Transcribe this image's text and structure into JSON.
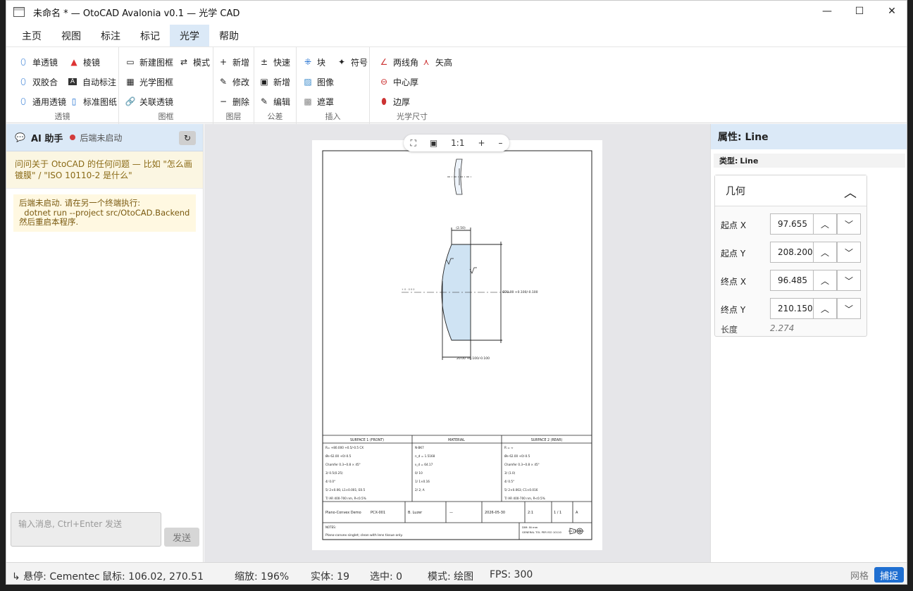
{
  "window": {
    "title": "未命名 * — OtoCAD Avalonia v0.1 — 光学 CAD",
    "min_glyph": "—",
    "max_glyph": "☐",
    "close_glyph": "✕"
  },
  "menu": [
    "主页",
    "视图",
    "标注",
    "标记",
    "光学",
    "帮助"
  ],
  "ribbon": {
    "groups": {
      "lens": "透镜",
      "frame": "图框",
      "layer": "图层",
      "tolerance": "公差",
      "insert": "插入",
      "optical_dim": "光学尺寸"
    },
    "lens": {
      "single": "单透镜",
      "doublet": "双胶合",
      "generic": "通用透镜",
      "prism": "棱镜",
      "auto_dim": "自动标注",
      "std_sheet": "标准图纸"
    },
    "frame": {
      "new": "新建图框",
      "mode": "模式",
      "optical": "光学图框",
      "link": "关联透镜"
    },
    "layer": {
      "add": "新增",
      "edit": "修改",
      "delete": "删除"
    },
    "tolerance": {
      "quick": "快速",
      "new": "新增",
      "edit": "编辑"
    },
    "insert": {
      "block": "块",
      "symbol": "符号",
      "image": "图像",
      "mask": "遮罩"
    },
    "optical_dim": {
      "two_line_angle": "两线角",
      "sag": "矢高",
      "center_thick": "中心厚",
      "edge_thick": "边厚"
    }
  },
  "ai": {
    "title": "AI 助手",
    "status": "后端未启动",
    "hint": "问问关于 OtoCAD 的任何问题 — 比如 \"怎么画镀膜\" / \"ISO 10110-2 是什么\"",
    "warn_lines": [
      "后端未启动. 请在另一个终端执行:",
      "  dotnet run --project src/OtoCAD.Backend",
      "然后重启本程序."
    ],
    "placeholder": "输入消息, Ctrl+Enter 发送",
    "send": "发送"
  },
  "zoom_toolbar": {
    "fit": "⛶",
    "frame": "▣",
    "one_to_one": "1:1",
    "plus": "+",
    "minus": "–"
  },
  "drawing": {
    "dim_top": "(2.50)",
    "dim_diameter": "Ø70.00 +0.100/-0.100",
    "dim_bottom": "20.00 +0.100/-0.100",
    "axis_label": "+ 0 . 0 0 0",
    "table_headers": [
      "SURFACE 1 (FRONT)",
      "MATERIAL",
      "SURFACE 2 (REAR)"
    ],
    "surface1": [
      "R= +80.000 +0.5/-0.5 CX",
      "Øe 62.00 +0/-0.5",
      "Chamfer 0.3~0.8 × 45°",
      "3/ 0.5(0.25)",
      "4/ 0.0°",
      "5/ 2×0.06; L1×0.001; E0.5",
      "T/ AR 400-700 nm, R<0.5%"
    ],
    "material": [
      "N-BK7",
      "n_d = 1.5168",
      "ν_d = 64.17",
      "0/ 10",
      "1/ 1×0.16",
      "2/ 2; A"
    ],
    "surface2": [
      "R = ∞",
      "Øe 62.00 +0/-0.5",
      "Chamfer 0.3~0.8 × 45°",
      "3/ (1.0)",
      "4/ 0.5°",
      "5/ 2×0.063; C1×0.016",
      "T/ AR 400-700 nm, R<0.5%"
    ],
    "title_block": {
      "name": "Plano-Convex Demo",
      "code": "PCX-001",
      "author": "B. Luzer",
      "dash": "—",
      "date": "2026-05-30",
      "scale": "2:1",
      "sheet": "1 / 1",
      "rev": "A",
      "notes_title": "NOTES:",
      "notes_text": "Plano-convex singlet; clean with lens tissue only.",
      "dim_note": "DIM: IN mm",
      "tol_note": "GENERAL TOL PER ISO 10110"
    }
  },
  "props": {
    "title": "属性: Line",
    "type_label": "类型:",
    "type_value": "Line",
    "group": "几何",
    "rows": [
      {
        "label": "起点 X",
        "value": "97.655"
      },
      {
        "label": "起点 Y",
        "value": "208.200"
      },
      {
        "label": "终点 X",
        "value": "96.485"
      },
      {
        "label": "终点 Y",
        "value": "210.150"
      }
    ],
    "length_label": "长度",
    "length_value": "2.274"
  },
  "status": {
    "hover": "↳ 悬停: Cementec",
    "mouse": "鼠标: 106.02, 270.51",
    "zoom": "缩放: 196%",
    "entities": "实体: 19",
    "selected": "选中: 0",
    "mode": "模式: 绘图",
    "fps": "FPS: 300",
    "grid": "网格",
    "snap": "捕捉"
  },
  "colors": {
    "accent": "#1f6fd1",
    "panel_header": "#dbe9f7",
    "lens_fill": "#cfe3f3",
    "status_dot": "#d23b3b"
  }
}
